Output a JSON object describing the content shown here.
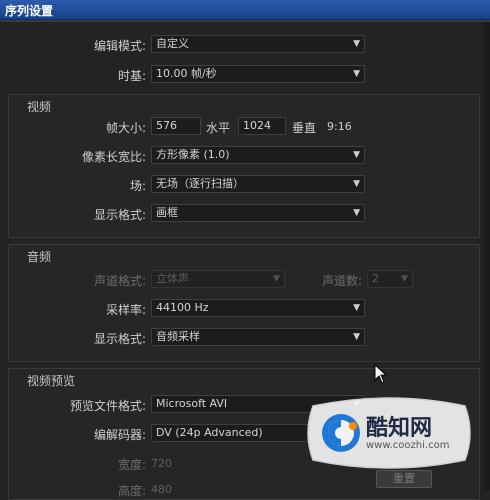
{
  "window": {
    "title": "序列设置"
  },
  "general": {
    "editing_mode_label": "编辑模式:",
    "editing_mode_value": "自定义",
    "timebase_label": "时基:",
    "timebase_value": "10.00  帧/秒"
  },
  "video": {
    "legend": "视频",
    "frame_size_label": "帧大小:",
    "frame_width": "576",
    "horizontal_label": "水平",
    "frame_height": "1024",
    "vertical_label": "垂直",
    "aspect": "9:16",
    "pixel_aspect_label": "像素长宽比:",
    "pixel_aspect_value": "方形像素 (1.0)",
    "fields_label": "场:",
    "fields_value": "无场（逐行扫描）",
    "display_format_label": "显示格式:",
    "display_format_value": "画框"
  },
  "audio": {
    "legend": "音频",
    "channel_format_label": "声道格式:",
    "channel_format_value": "立体声",
    "channel_count_label": "声道数:",
    "channel_count_value": "2",
    "sample_rate_label": "采样率:",
    "sample_rate_value": "44100 Hz",
    "display_format_label": "显示格式:",
    "display_format_value": "音频采样"
  },
  "preview": {
    "legend": "视频预览",
    "file_format_label": "预览文件格式:",
    "file_format_value": "Microsoft AVI",
    "codec_label": "编解码器:",
    "codec_value": "DV (24p Advanced)",
    "width_label": "宽度:",
    "width_value": "720",
    "height_label": "高度:",
    "height_value": "480",
    "reset_label": "重置"
  },
  "watermark": {
    "brand": "酷知网",
    "url": "www.coozhi.com"
  },
  "colors": {
    "titlebar": "#1f4d9c",
    "panel": "#262626",
    "field": "#1c1c1c"
  }
}
